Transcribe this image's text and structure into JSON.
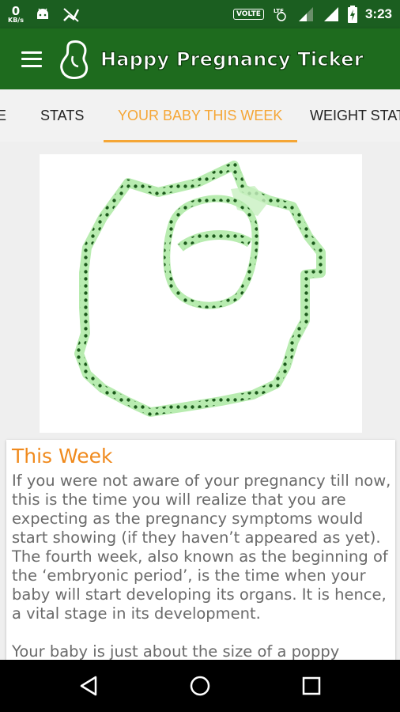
{
  "status_bar": {
    "net_speed_value": "0",
    "net_speed_unit": "KB/s",
    "volte": "VOLTE",
    "lte": "LTE",
    "time": "3:23",
    "icons": [
      "android-icon",
      "signal-off-icon",
      "vibrate-icon",
      "signal-icon",
      "wifi-signal-icon",
      "battery-charging-icon"
    ]
  },
  "app_bar": {
    "title": "Happy Pregnancy Ticker",
    "menu_icon": "hamburger-menu-icon",
    "logo_icon": "pregnant-silhouette-icon"
  },
  "tabs": [
    {
      "label": "E"
    },
    {
      "label": "STATS"
    },
    {
      "label": "YOUR BABY THIS WEEK",
      "active": true
    },
    {
      "label": "WEIGHT STATS"
    }
  ],
  "illustration": {
    "subject": "embryo-week-4-illustration",
    "colors": {
      "fill": "#c8f0c0",
      "dots": "#1c5a1c",
      "outline": "#9ee29a"
    }
  },
  "content": {
    "title": "This Week",
    "paragraphs": [
      "If you were not aware of your pregnancy till now, this is the time you will realize that you are expecting as the pregnancy symptoms would start showing (if they haven’t appeared as yet). The fourth week, also known as the beginning of the ‘embryonic period’, is the time when your baby will start developing its organs. It is hence, a vital stage in its development.",
      "Your baby is just about the size of a poppy"
    ]
  },
  "colors": {
    "status_bar": "#1b5e20",
    "app_bar": "#1e6b1e",
    "tab_active": "#f5a636",
    "title_orange": "#f08a1d",
    "body_text": "#6a6a6a"
  },
  "nav_bar": {
    "buttons": [
      "back-icon",
      "home-icon",
      "recents-icon"
    ]
  }
}
